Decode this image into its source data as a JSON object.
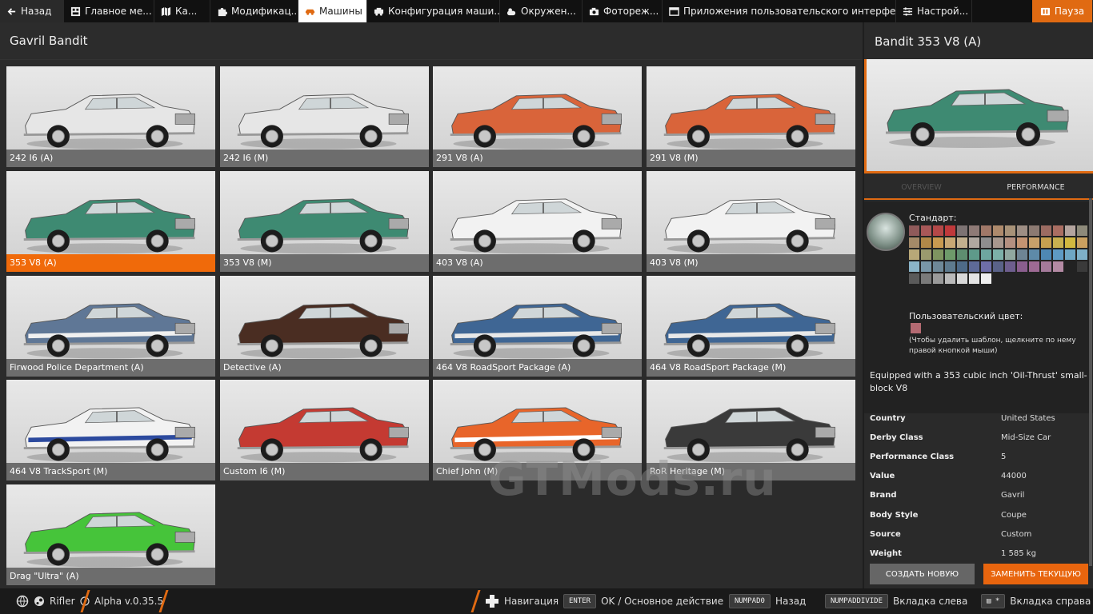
{
  "topbar": {
    "back": "Назад",
    "tabs": [
      {
        "label": "Главное ме...",
        "icon": "main-menu-icon"
      },
      {
        "label": "Ка...",
        "icon": "map-icon"
      },
      {
        "label": "Модификац...",
        "icon": "puzzle-icon"
      },
      {
        "label": "Машины",
        "icon": "car-icon"
      },
      {
        "label": "Конфигурация маши...",
        "icon": "car-config-icon"
      },
      {
        "label": "Окружен...",
        "icon": "weather-icon"
      },
      {
        "label": "Фотореж...",
        "icon": "camera-icon"
      },
      {
        "label": "Приложения пользовательского интерфе...",
        "icon": "apps-icon"
      },
      {
        "label": "Настрой...",
        "icon": "settings-icon"
      }
    ],
    "pause": "Пауза"
  },
  "left": {
    "title": "Gavril Bandit",
    "tiles": [
      {
        "label": "242 I6 (A)",
        "body": "#e6e6e6",
        "stripe": ""
      },
      {
        "label": "242 I6 (M)",
        "body": "#e6e6e6",
        "stripe": ""
      },
      {
        "label": "291 V8 (A)",
        "body": "#d9643a",
        "stripe": ""
      },
      {
        "label": "291 V8 (M)",
        "body": "#d9643a",
        "stripe": ""
      },
      {
        "label": "353 V8 (A)",
        "body": "#3e8a72",
        "stripe": ""
      },
      {
        "label": "353 V8 (M)",
        "body": "#3e8a72",
        "stripe": ""
      },
      {
        "label": "403 V8 (A)",
        "body": "#f2f2f2",
        "stripe": ""
      },
      {
        "label": "403 V8 (M)",
        "body": "#f2f2f2",
        "stripe": ""
      },
      {
        "label": "Firwood Police Department (A)",
        "body": "#5f7796",
        "stripe": "#f0f0f0"
      },
      {
        "label": "Detective (A)",
        "body": "#4a2d22",
        "stripe": ""
      },
      {
        "label": "464 V8 RoadSport Package (A)",
        "body": "#3f6694",
        "stripe": "#e8e8e8"
      },
      {
        "label": "464 V8 RoadSport Package (M)",
        "body": "#3f6694",
        "stripe": "#e8e8e8"
      },
      {
        "label": "464 V8 TrackSport (M)",
        "body": "#f2f2f2",
        "stripe": "#2c4a9e"
      },
      {
        "label": "Custom I6 (M)",
        "body": "#c43a32",
        "stripe": ""
      },
      {
        "label": "Chief John (M)",
        "body": "#e8652a",
        "stripe": "#ffffff"
      },
      {
        "label": "RoR Heritage (M)",
        "body": "#3a3a3a",
        "stripe": ""
      },
      {
        "label": "Drag \"Ultra\" (A)",
        "body": "#46c43a",
        "stripe": ""
      }
    ],
    "selected_index": 4,
    "watermark": "GTMods.ru"
  },
  "right": {
    "title": "Bandit 353 V8 (A)",
    "car_color": "#3e8a72",
    "tabs": [
      "OVERVIEW",
      "PERFORMANCE"
    ],
    "standard_label": "Стандарт:",
    "swatches": [
      "#8f5a5a",
      "#a85858",
      "#b44848",
      "#c0393b",
      "#7d7373",
      "#8e7a76",
      "#a07868",
      "#ae8a6c",
      "#a89278",
      "#9e8e84",
      "#8c7a72",
      "#9c6c62",
      "#aa6e62",
      "#b4a49e",
      "#8e8a7a",
      "#a48a68",
      "#b08848",
      "#c89a50",
      "#c8a874",
      "#c2b08e",
      "#b0a8a0",
      "#8e8e8e",
      "#a8988e",
      "#b49080",
      "#c49472",
      "#c8a06a",
      "#c6a050",
      "#c8b050",
      "#d2b840",
      "#caa060",
      "#b8a878",
      "#9a9a6e",
      "#7e9460",
      "#6e9a6a",
      "#5e8e70",
      "#5e9a8a",
      "#6ea6a0",
      "#7cb0a8",
      "#90a8a0",
      "#6e8494",
      "#5e8aa8",
      "#4e88b4",
      "#5e9ac4",
      "#6ea6c4",
      "#7eb0c8",
      "#8ab4c8",
      "#7896a8",
      "#6e8898",
      "#5e7a8e",
      "#4e6a88",
      "#5e6a98",
      "#6e6ea8",
      "#5a6288",
      "#6e5e8e",
      "#8a5e8e",
      "#9e6a94",
      "#a47a9a",
      "#b48aa4",
      "#222222",
      "#3a3a3a",
      "#5a5a5a",
      "#7a7a7a",
      "#9a9a9a",
      "#bababa",
      "#d8d8d8",
      "#e4e4e4",
      "#f0f0f0"
    ],
    "custom_label": "Пользовательский цвет:",
    "hint": "(Чтобы удалить шаблон, щелкните по нему правой кнопкой мыши)",
    "description": "Equipped with a 353 cubic inch 'Oil-Thrust' small-block V8",
    "specs": [
      {
        "k": "Country",
        "v": "United States"
      },
      {
        "k": "Derby Class",
        "v": "Mid-Size Car"
      },
      {
        "k": "Performance Class",
        "v": "5"
      },
      {
        "k": "Value",
        "v": "44000"
      },
      {
        "k": "Brand",
        "v": "Gavril"
      },
      {
        "k": "Body Style",
        "v": "Coupe"
      },
      {
        "k": "Source",
        "v": "Custom"
      },
      {
        "k": "Weight",
        "v": "1 585 kg"
      }
    ],
    "btn_new": "СОЗДАТЬ НОВУЮ",
    "btn_replace": "ЗАМЕНИТЬ ТЕКУЩУЮ"
  },
  "bottombar": {
    "user": "Rifler",
    "version": "Alpha v.0.35.5",
    "nav_label": "Навигация",
    "enter_key": "ENTER",
    "enter_label": "OK / Основное действие",
    "back_key": "NUMPAD0",
    "back_label": "Назад",
    "tab_left_key": "NUMPADDIVIDE",
    "tab_left_label": "Вкладка слева",
    "tab_right_key": "*",
    "tab_right_label": "Вкладка справа"
  },
  "colors": {
    "accent": "#e06a12"
  }
}
